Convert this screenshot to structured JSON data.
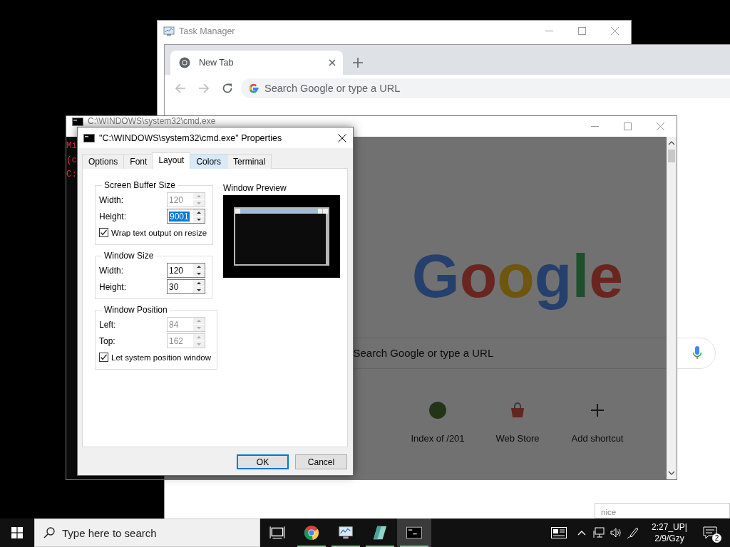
{
  "task_manager": {
    "title": "Task Manager"
  },
  "browser": {
    "tabs": [
      {
        "label": "New Tab",
        "selected": true
      }
    ],
    "omnibox": {
      "placeholder": "Search Google or type a URL"
    },
    "page": {
      "logo": "Google",
      "search": {
        "placeholder": "Search Google or type a URL"
      },
      "shortcuts": [
        {
          "kind": "site",
          "label": "Index of /201"
        },
        {
          "kind": "store",
          "label": "Web Store"
        },
        {
          "kind": "add",
          "label": "Add shortcut"
        }
      ]
    }
  },
  "console": {
    "title": "C:\\WINDOWS\\system32\\cmd.exe",
    "lines": [
      "Mi",
      "(c",
      "C:"
    ]
  },
  "dialog": {
    "title": "\"C:\\WINDOWS\\system32\\cmd.exe\" Properties",
    "tabs": [
      {
        "label": "Options",
        "selected": false,
        "hovered": false
      },
      {
        "label": "Font",
        "selected": false,
        "hovered": false
      },
      {
        "label": "Layout",
        "selected": true,
        "hovered": false
      },
      {
        "label": "Colors",
        "selected": false,
        "hovered": true
      },
      {
        "label": "Terminal",
        "selected": false,
        "hovered": false
      }
    ],
    "groups": [
      {
        "title": "Screen Buffer Size",
        "fields": [
          {
            "label": "Width:",
            "value": "120",
            "disabled": true,
            "highlighted": false
          },
          {
            "label": "Height:",
            "value": "9001",
            "disabled": false,
            "highlighted": true
          }
        ],
        "checkbox": {
          "label": "Wrap text output on resize",
          "checked": true
        }
      },
      {
        "title": "Window Size",
        "fields": [
          {
            "label": "Width:",
            "value": "120",
            "disabled": false,
            "highlighted": false
          },
          {
            "label": "Height:",
            "value": "30",
            "disabled": false,
            "highlighted": false
          }
        ]
      },
      {
        "title": "Window Position",
        "fields": [
          {
            "label": "Left:",
            "value": "84",
            "disabled": true,
            "highlighted": false
          },
          {
            "label": "Top:",
            "value": "162",
            "disabled": true,
            "highlighted": false
          }
        ],
        "checkbox": {
          "label": "Let system position window",
          "checked": true
        }
      }
    ],
    "preview": {
      "title": "Window Preview"
    },
    "buttons": [
      {
        "label": "OK",
        "default": true
      },
      {
        "label": "Cancel",
        "default": false
      }
    ]
  },
  "notification_popup": {
    "text": "nice"
  },
  "taskbar": {
    "search": {
      "placeholder": "Type here to search"
    },
    "apps": [
      {
        "kind": "task-view",
        "running": false,
        "active": false
      },
      {
        "kind": "chrome",
        "running": true,
        "active": false
      },
      {
        "kind": "task-manager",
        "running": true,
        "active": false
      },
      {
        "kind": "app",
        "running": true,
        "active": false
      },
      {
        "kind": "console",
        "running": true,
        "active": true
      }
    ],
    "clock": {
      "time": "2:27_UP|",
      "date": "2/9/Gzy"
    },
    "notifications": {
      "count": "2"
    }
  }
}
